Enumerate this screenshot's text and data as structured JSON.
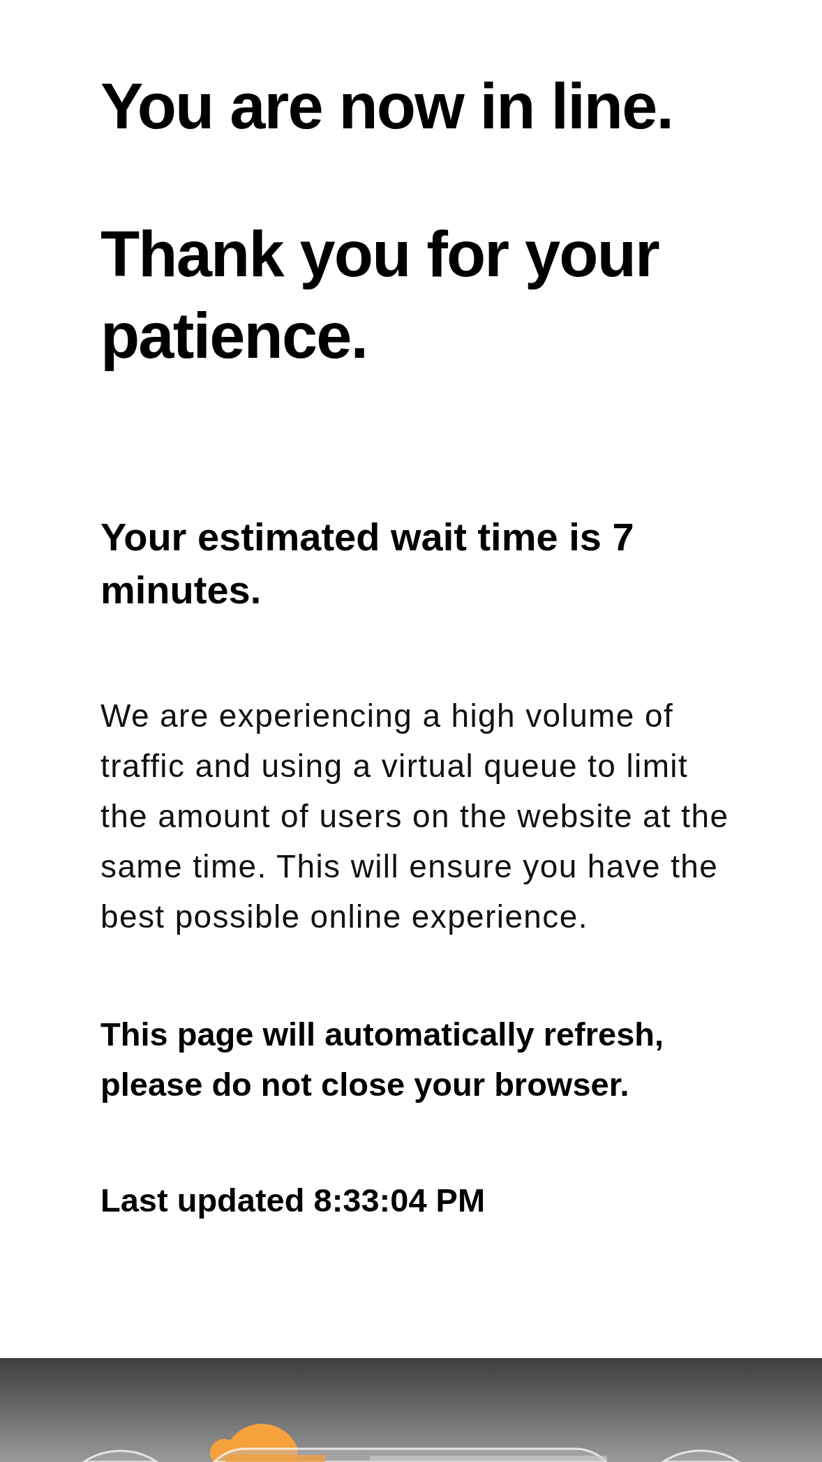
{
  "headings": [
    "You are now in line.",
    "Thank you for your patience."
  ],
  "wait_time": "Your estimated wait time is 7 minutes.",
  "message": "We are experiencing a high volume of traffic and using a virtual queue to limit the amount of users on the website at the same time. This will ensure you have the best possible online experience.",
  "refresh_notice": "This page will automatically refresh, please do not close your browser.",
  "last_updated": "Last updated 8:33:04 PM"
}
